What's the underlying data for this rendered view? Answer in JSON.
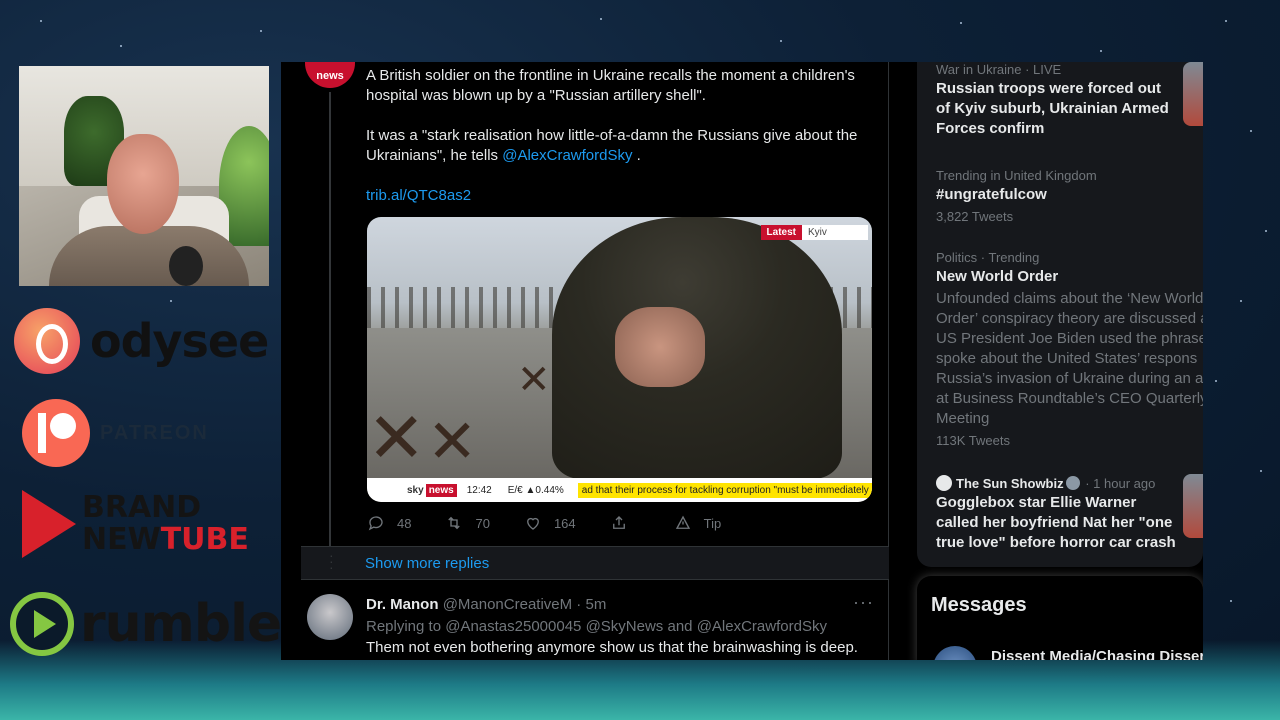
{
  "logos": {
    "odysee": "odysee",
    "patreon": "PATREON",
    "brand_line1": "BRAND",
    "brand_new": "NEW",
    "brand_tube": "TUBE",
    "rumble": "rumble"
  },
  "tweet": {
    "avatar_label": "news",
    "paragraph1": "A British soldier on the frontline in Ukraine recalls the moment a children's hospital was blown up by a \"Russian artillery shell\".",
    "paragraph2_pre": "It was a \"stark realisation how little-of-a-damn the Russians give about the Ukrainians\", he tells ",
    "paragraph2_mention": "@AlexCrawfordSky",
    "paragraph2_post": " .",
    "link": "trib.al/QTC8as2",
    "media": {
      "latest": "Latest",
      "location": "Kyiv",
      "ticker_sky": "sky",
      "ticker_news": "news",
      "ticker_time": "12:42",
      "ticker_eur": "E/€ ▲0.44%",
      "ticker_scroll": "ad that their process for tackling corruption \"must be immediately im"
    },
    "replies_count": "48",
    "retweets_count": "70",
    "likes_count": "164",
    "tip_label": "Tip"
  },
  "show_more": "Show more replies",
  "reply": {
    "name": "Dr. Manon",
    "handle": "@ManonCreativeM",
    "time": "5m",
    "more": "···",
    "replying_label": "Replying to",
    "replying_1": "@Anastas25000045",
    "replying_2": "@SkyNews",
    "replying_and": "and",
    "replying_3": "@AlexCrawfordSky",
    "text": "Them not even bothering anymore show us that the brainwashing is deep."
  },
  "trends": [
    {
      "meta": "War in Ukraine · LIVE",
      "title": "Russian troops were forced out of Kyiv suburb, Ukrainian Armed Forces confirm"
    },
    {
      "meta": "Trending in United Kingdom",
      "title": "#ungratefulcow",
      "count": "3,822 Tweets"
    },
    {
      "meta": "Politics · Trending",
      "title": "New World Order",
      "desc": [
        "Unfounded claims about the ‘New World",
        "Order’ conspiracy theory are discussed a",
        "US President Joe Biden used the phrase",
        "spoke about the United States’ respons",
        "Russia’s invasion of Ukraine during an a",
        "at Business Roundtable’s CEO Quarterly",
        "Meeting"
      ],
      "count": "113K Tweets"
    },
    {
      "source": "The Sun Showbiz",
      "time": "· 1 hour ago",
      "title": "Gogglebox star Ellie Warner called her boyfriend Nat her \"one true love\" before horror car crash"
    }
  ],
  "messages": {
    "header": "Messages",
    "dm_name": "Dissent Media/Chasing Disser"
  }
}
